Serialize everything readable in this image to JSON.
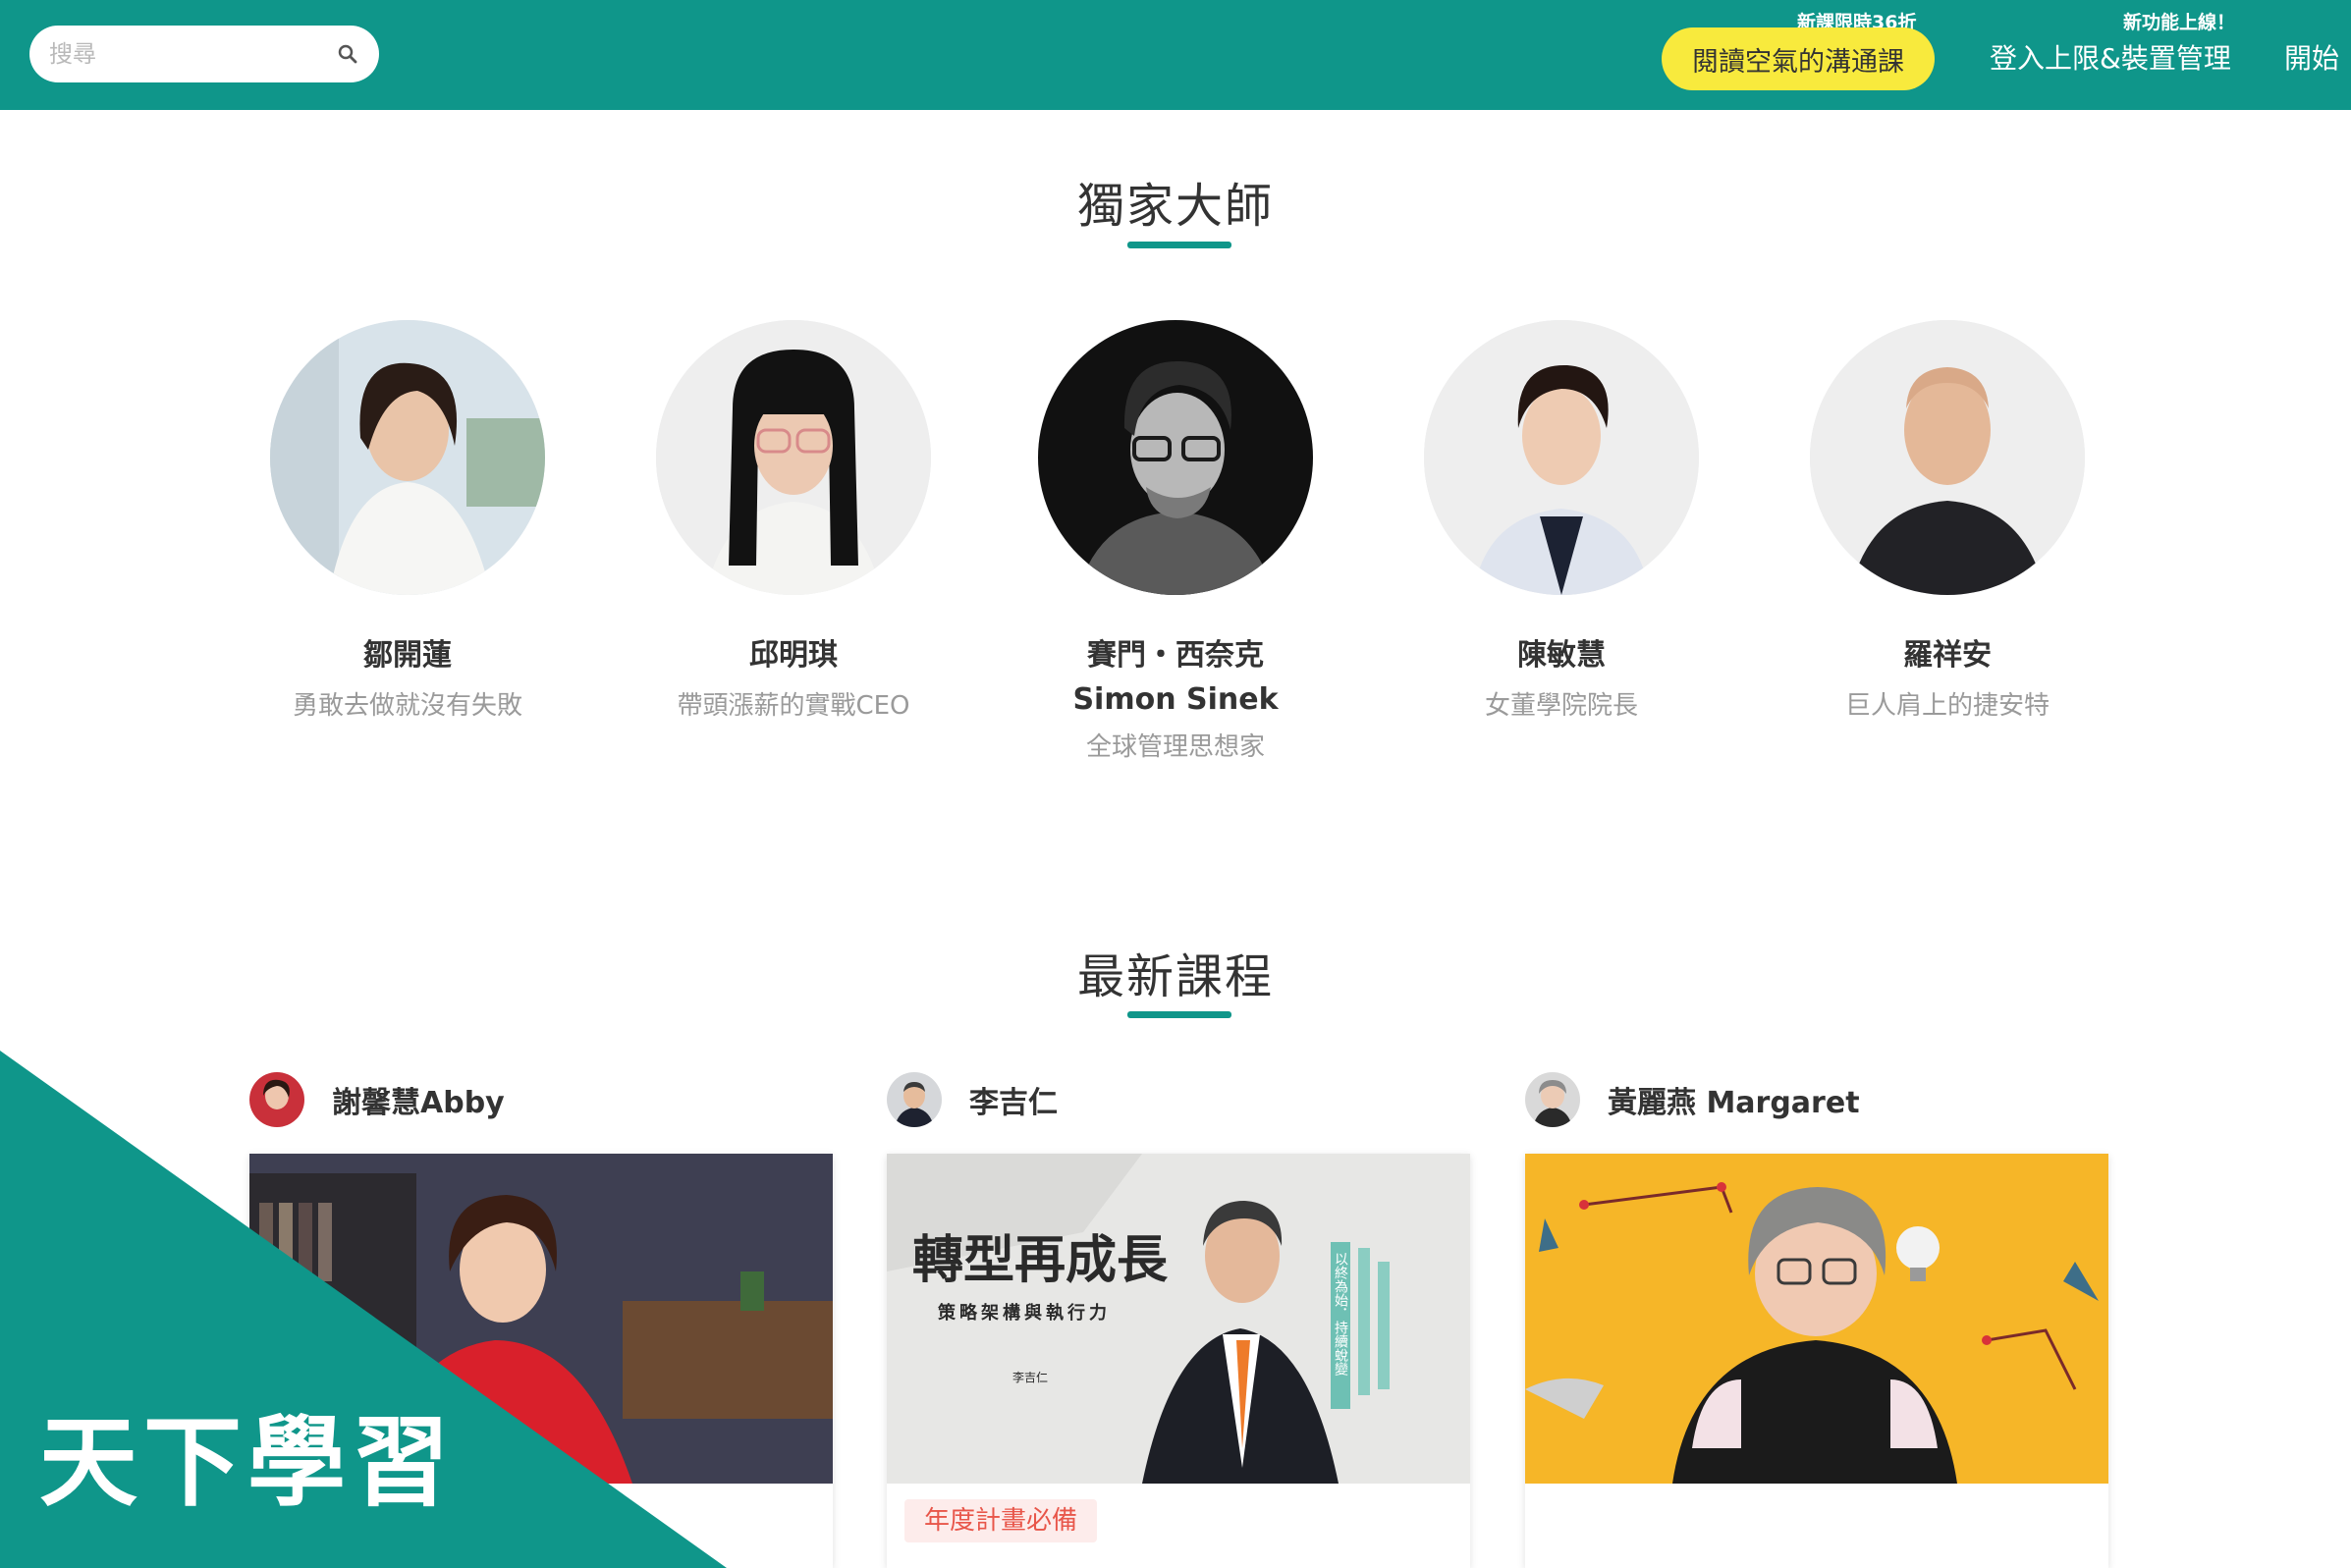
{
  "header": {
    "search_placeholder": "搜尋",
    "promo_button": "閱讀空氣的溝通課",
    "promo_badge": "新課限時36折",
    "nav_login": "登入上限&裝置管理",
    "nav_login_badge": "新功能上線！",
    "nav_start": "開始",
    "brand_color": "#0f968a",
    "promo_color": "#f8ea3d"
  },
  "masters_section": {
    "title": "獨家大師",
    "masters": [
      {
        "name": "鄒開蓮",
        "desc": "勇敢去做就沒有失敗"
      },
      {
        "name": "邱明琪",
        "desc": "帶頭漲薪的實戰CEO"
      },
      {
        "name": "賽門・西奈克",
        "name_en": "Simon Sinek",
        "desc": "全球管理思想家"
      },
      {
        "name": "陳敏慧",
        "desc": "女董學院院長"
      },
      {
        "name": "羅祥安",
        "desc": "巨人肩上的捷安特"
      }
    ]
  },
  "courses_section": {
    "title": "最新課程",
    "courses": [
      {
        "teacher": "謝馨慧Abby"
      },
      {
        "teacher": "李吉仁",
        "cover_title": "轉型再成長",
        "cover_subtitle": "策略架構與執行力",
        "cover_author": "李吉仁",
        "cover_vertical": "以終為始．持續蛻變",
        "tag": "年度計畫必備"
      },
      {
        "teacher": "黃麗燕 Margaret"
      }
    ]
  },
  "brand": {
    "logo_text": "天下學習"
  }
}
